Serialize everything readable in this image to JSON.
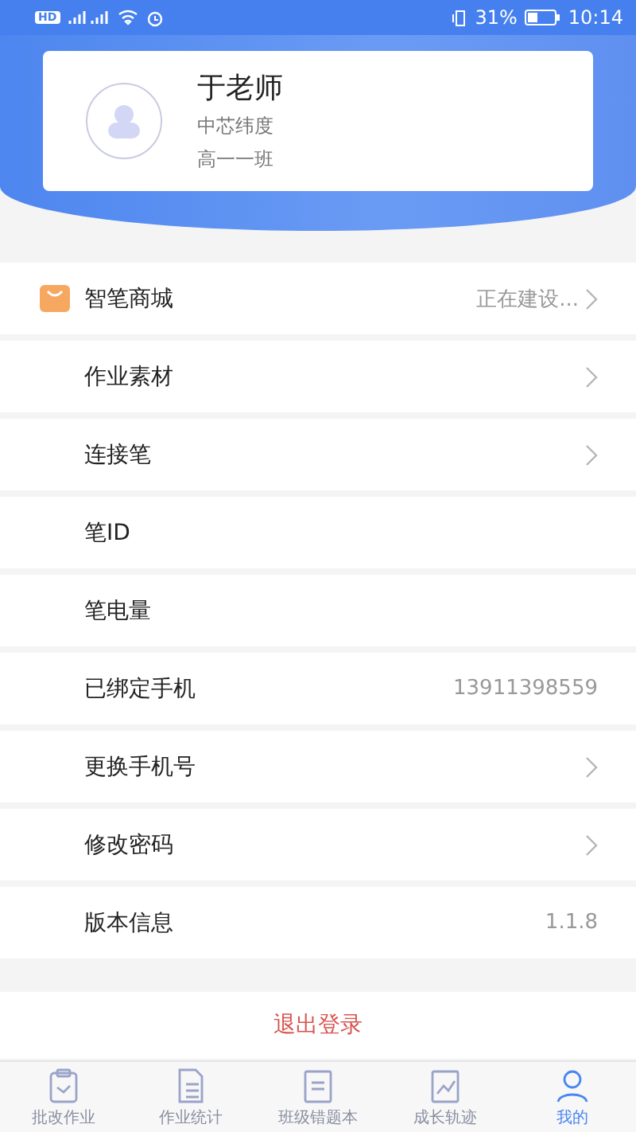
{
  "status_bar": {
    "network": "HD",
    "battery": "31%",
    "time": "10:14"
  },
  "profile": {
    "name": "于老师",
    "school": "中芯纬度",
    "class": "高一一班"
  },
  "menu": [
    {
      "kind": "shop",
      "label": "智笔商城",
      "value": "正在建设...",
      "chevron": true
    },
    {
      "kind": "plain",
      "label": "作业素材",
      "chevron": true
    },
    {
      "kind": "plain",
      "label": "连接笔",
      "chevron": true
    },
    {
      "kind": "plain",
      "label": "笔ID",
      "chevron": false
    },
    {
      "kind": "plain",
      "label": "笔电量",
      "chevron": false
    },
    {
      "kind": "plain",
      "label": "已绑定手机",
      "value": "13911398559",
      "chevron": false
    },
    {
      "kind": "plain",
      "label": "更换手机号",
      "chevron": true
    },
    {
      "kind": "plain",
      "label": "修改密码",
      "chevron": true
    },
    {
      "kind": "plain",
      "label": "版本信息",
      "value": "1.1.8",
      "chevron": false
    }
  ],
  "logout": "退出登录",
  "tabs": [
    {
      "kind": "grade",
      "label": "批改作业",
      "selected": false
    },
    {
      "kind": "stats",
      "label": "作业统计",
      "selected": false
    },
    {
      "kind": "book",
      "label": "班级错题本",
      "selected": false
    },
    {
      "kind": "growth",
      "label": "成长轨迹",
      "selected": false
    },
    {
      "kind": "me",
      "label": "我的",
      "selected": true
    }
  ]
}
